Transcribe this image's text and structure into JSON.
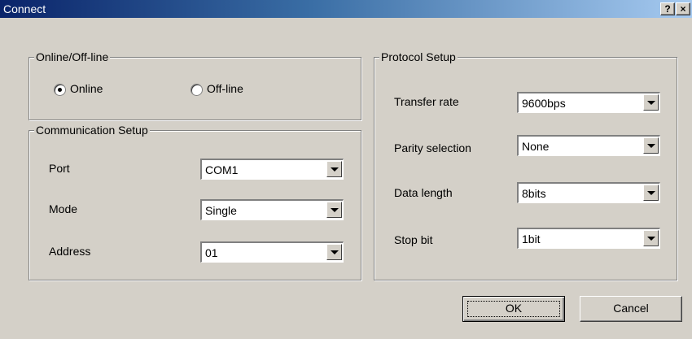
{
  "window": {
    "title": "Connect",
    "help_label": "?",
    "close_label": "×"
  },
  "online_group": {
    "legend": "Online/Off-line",
    "online_label": "Online",
    "offline_label": "Off-line",
    "selected": "Online"
  },
  "comm_group": {
    "legend": "Communication Setup",
    "port_label": "Port",
    "port_value": "COM1",
    "mode_label": "Mode",
    "mode_value": "Single",
    "address_label": "Address",
    "address_value": "01"
  },
  "protocol_group": {
    "legend": "Protocol Setup",
    "transfer_label": "Transfer rate",
    "transfer_value": "9600bps",
    "parity_label": "Parity selection",
    "parity_value": "None",
    "datalen_label": "Data length",
    "datalen_value": "8bits",
    "stopbit_label": "Stop bit",
    "stopbit_value": "1bit"
  },
  "buttons": {
    "ok_label": "OK",
    "cancel_label": "Cancel"
  }
}
